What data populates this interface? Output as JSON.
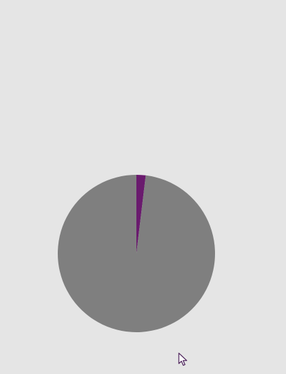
{
  "chart_data": {
    "type": "pie",
    "slices": [
      {
        "value": 98.1,
        "color": "#7f7f7f"
      },
      {
        "value": 1.9,
        "color": "#6a1b6e"
      }
    ]
  },
  "colors": {
    "background": "#e5e5e5"
  },
  "cursor": {
    "icon": "mouse-pointer-icon"
  }
}
